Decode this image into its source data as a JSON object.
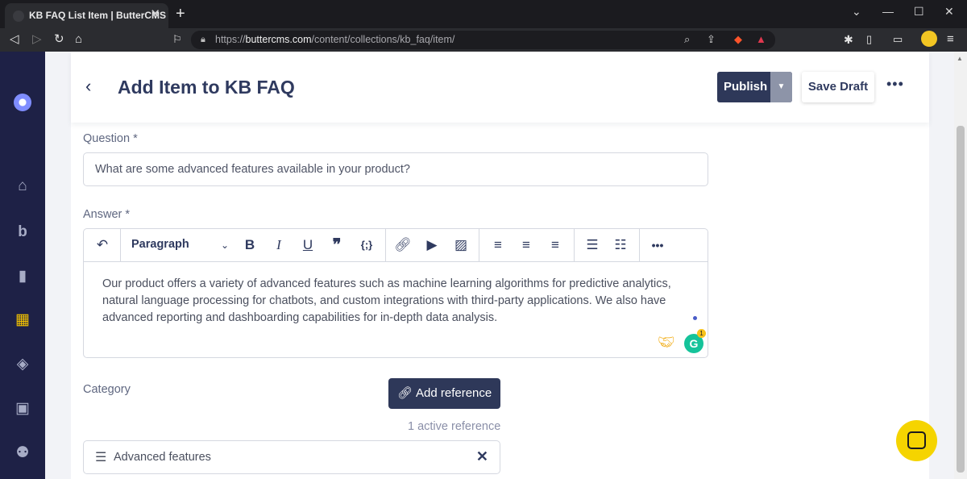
{
  "browser": {
    "tab_title": "KB FAQ List Item | ButterCMS",
    "tab_close": "✕",
    "new_tab": "+",
    "url_prefix": "https://",
    "url_host": "buttercms.com",
    "url_path": "/content/collections/kb_faq/item/",
    "window_controls": [
      "⌄",
      "—",
      "☐",
      "✕"
    ]
  },
  "sidebar": {
    "items": [
      {
        "name": "home",
        "icon": "⌂"
      },
      {
        "name": "blog",
        "icon": "b"
      },
      {
        "name": "pages",
        "icon": "▮"
      },
      {
        "name": "collections",
        "icon": "▦",
        "active": true
      },
      {
        "name": "components",
        "icon": "◈"
      },
      {
        "name": "media",
        "icon": "▣"
      },
      {
        "name": "users",
        "icon": "⚉"
      }
    ]
  },
  "header": {
    "back": "‹",
    "title": "Add Item to KB FAQ",
    "publish_label": "Publish",
    "save_draft_label": "Save Draft",
    "more": "•••"
  },
  "form": {
    "question_label": "Question *",
    "question_value": "What are some advanced features available in your product?",
    "answer_label": "Answer *",
    "toolbar": {
      "paragraph": "Paragraph"
    },
    "answer_value": "Our product offers a variety of advanced features such as machine learning algorithms for predictive analytics, natural language processing for chatbots, and custom integrations with third-party applications. We also have advanced reporting and dashboarding capabilities for in-depth data analysis.",
    "grammarly_count": "1",
    "category_label": "Category",
    "add_reference_label": "Add reference",
    "active_reference_count": "1 active reference",
    "reference_item": "Advanced features"
  },
  "colors": {
    "primary": "#2e3859",
    "sidebar": "#1e2146",
    "accent": "#f5c400"
  }
}
